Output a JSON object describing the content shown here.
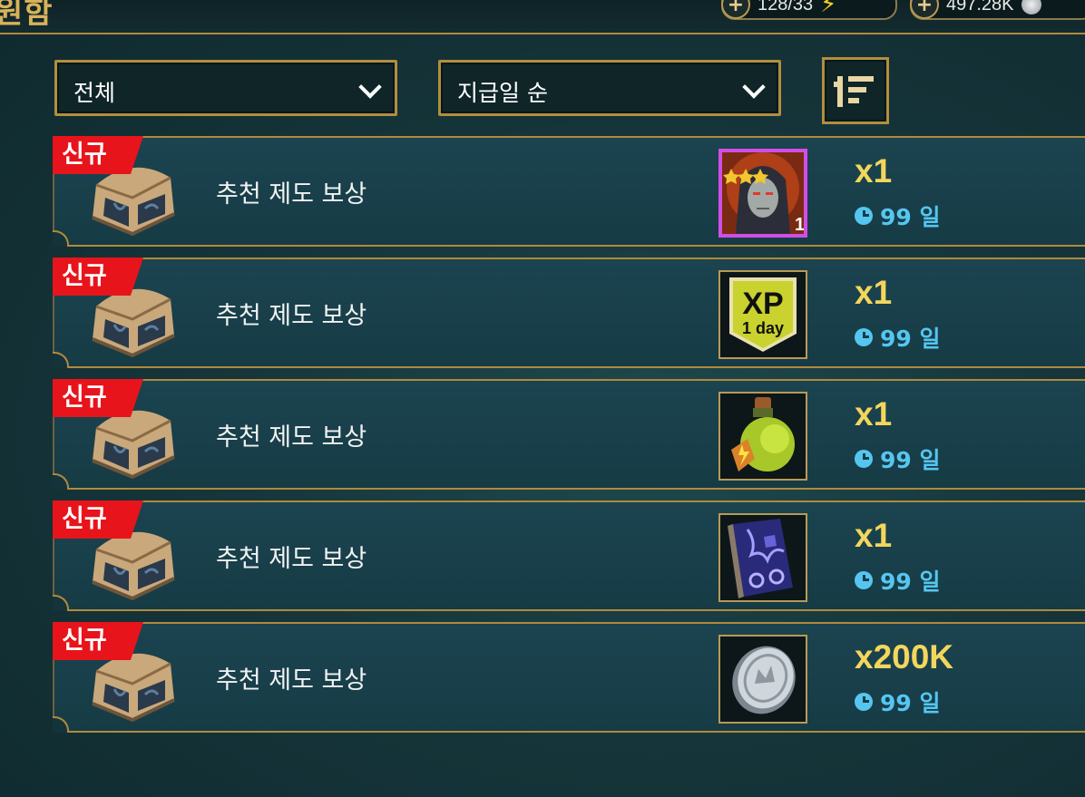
{
  "header": {
    "title_fragment": "원함",
    "resources": [
      {
        "value": "128/33",
        "icon": "lightning-icon"
      },
      {
        "value": "497.28K",
        "icon": "silver-coin-icon"
      }
    ]
  },
  "filters": {
    "category_label": "전체",
    "sort_label": "지급일 순",
    "sort_button_icon": "sort-descending-icon"
  },
  "rewards": [
    {
      "badge": "신규",
      "title": "추천 제도 보상",
      "item": "champion-portrait",
      "item_level": "1",
      "quantity": "x1",
      "time_left": "99 일"
    },
    {
      "badge": "신규",
      "title": "추천 제도 보상",
      "item": "xp-boost",
      "item_text_main": "XP",
      "item_text_sub": "1 day",
      "quantity": "x1",
      "time_left": "99 일"
    },
    {
      "badge": "신규",
      "title": "추천 제도 보상",
      "item": "energy-potion",
      "quantity": "x1",
      "time_left": "99 일"
    },
    {
      "badge": "신규",
      "title": "추천 제도 보상",
      "item": "mystery-tome",
      "quantity": "x1",
      "time_left": "99 일"
    },
    {
      "badge": "신규",
      "title": "추천 제도 보상",
      "item": "silver-coin",
      "quantity": "x200K",
      "time_left": "99 일"
    }
  ],
  "colors": {
    "gold_border": "#b08a3c",
    "new_badge": "#e8141b",
    "quantity": "#f3d65c",
    "timer": "#55c6f0",
    "epic_frame": "#d14ee6"
  }
}
